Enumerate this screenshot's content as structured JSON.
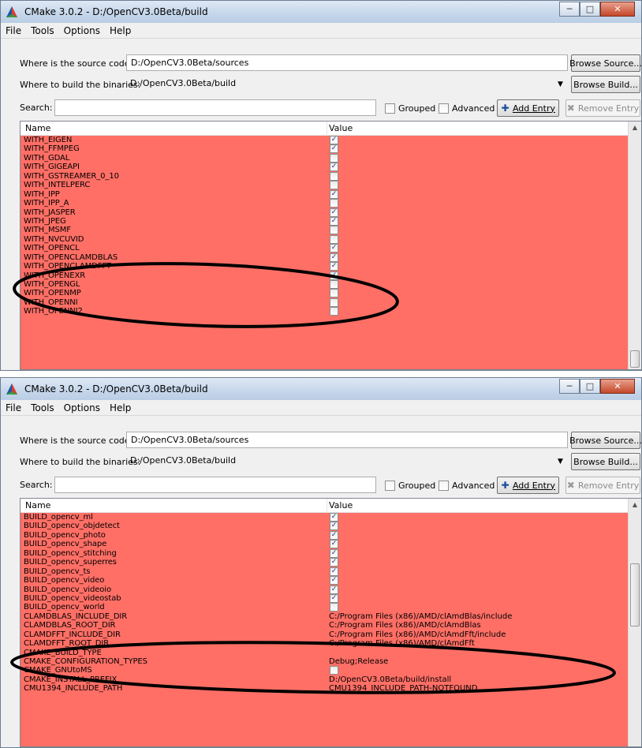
{
  "windows": [
    {
      "title": "CMake 3.0.2 - D:/OpenCV3.0Beta/build",
      "menu": [
        "File",
        "Tools",
        "Options",
        "Help"
      ],
      "source_label": "Where is the source code:",
      "source_value": "D:/OpenCV3.0Beta/sources",
      "browse_source": "Browse Source...",
      "build_label": "Where to build the binaries:",
      "build_value": "D:/OpenCV3.0Beta/build",
      "browse_build": "Browse Build...",
      "search_label": "Search:",
      "search_value": "",
      "grouped_label": "Grouped",
      "advanced_label": "Advanced",
      "add_entry": "Add Entry",
      "remove_entry": "Remove Entry",
      "col_name": "Name",
      "col_value": "Value",
      "rows": [
        {
          "name": "WITH_EIGEN",
          "checked": true
        },
        {
          "name": "WITH_FFMPEG",
          "checked": true
        },
        {
          "name": "WITH_GDAL",
          "checked": false
        },
        {
          "name": "WITH_GIGEAPI",
          "checked": true
        },
        {
          "name": "WITH_GSTREAMER_0_10",
          "checked": false
        },
        {
          "name": "WITH_INTELPERC",
          "checked": false
        },
        {
          "name": "WITH_IPP",
          "checked": true
        },
        {
          "name": "WITH_IPP_A",
          "checked": false
        },
        {
          "name": "WITH_JASPER",
          "checked": true
        },
        {
          "name": "WITH_JPEG",
          "checked": true
        },
        {
          "name": "WITH_MSMF",
          "checked": false
        },
        {
          "name": "WITH_NVCUVID",
          "checked": false
        },
        {
          "name": "WITH_OPENCL",
          "checked": true
        },
        {
          "name": "WITH_OPENCLAMDBLAS",
          "checked": true
        },
        {
          "name": "WITH_OPENCLAMDFFT",
          "checked": true
        },
        {
          "name": "WITH_OPENEXR",
          "checked": true
        },
        {
          "name": "WITH_OPENGL",
          "checked": false
        },
        {
          "name": "WITH_OPENMP",
          "checked": false
        },
        {
          "name": "WITH_OPENNI",
          "checked": false
        },
        {
          "name": "WITH_OPENNI2",
          "checked": false
        }
      ]
    },
    {
      "title": "CMake 3.0.2 - D:/OpenCV3.0Beta/build",
      "menu": [
        "File",
        "Tools",
        "Options",
        "Help"
      ],
      "source_label": "Where is the source code:",
      "source_value": "D:/OpenCV3.0Beta/sources",
      "browse_source": "Browse Source...",
      "build_label": "Where to build the binaries:",
      "build_value": "D:/OpenCV3.0Beta/build",
      "browse_build": "Browse Build...",
      "search_label": "Search:",
      "search_value": "",
      "grouped_label": "Grouped",
      "advanced_label": "Advanced",
      "add_entry": "Add Entry",
      "remove_entry": "Remove Entry",
      "col_name": "Name",
      "col_value": "Value",
      "rows": [
        {
          "name": "BUILD_opencv_ml",
          "checked": true
        },
        {
          "name": "BUILD_opencv_objdetect",
          "checked": true
        },
        {
          "name": "BUILD_opencv_photo",
          "checked": true
        },
        {
          "name": "BUILD_opencv_shape",
          "checked": true
        },
        {
          "name": "BUILD_opencv_stitching",
          "checked": true
        },
        {
          "name": "BUILD_opencv_superres",
          "checked": true
        },
        {
          "name": "BUILD_opencv_ts",
          "checked": true
        },
        {
          "name": "BUILD_opencv_video",
          "checked": true
        },
        {
          "name": "BUILD_opencv_videoio",
          "checked": true
        },
        {
          "name": "BUILD_opencv_videostab",
          "checked": true
        },
        {
          "name": "BUILD_opencv_world",
          "checked": false
        },
        {
          "name": "CLAMDBLAS_INCLUDE_DIR",
          "value": "C:/Program Files (x86)/AMD/clAmdBlas/include"
        },
        {
          "name": "CLAMDBLAS_ROOT_DIR",
          "value": "C:/Program Files (x86)/AMD/clAmdBlas"
        },
        {
          "name": "CLAMDFFT_INCLUDE_DIR",
          "value": "C:/Program Files (x86)/AMD/clAmdFft/include"
        },
        {
          "name": "CLAMDFFT_ROOT_DIR",
          "value": "C:/Program Files (x86)/AMD/clAmdFft"
        },
        {
          "name": "CMAKE_BUILD_TYPE",
          "value": ""
        },
        {
          "name": "CMAKE_CONFIGURATION_TYPES",
          "value": "Debug;Release"
        },
        {
          "name": "CMAKE_GNUtoMS",
          "checked": false
        },
        {
          "name": "CMAKE_INSTALL_PREFIX",
          "value": "D:/OpenCV3.0Beta/build/install"
        },
        {
          "name": "CMU1394_INCLUDE_PATH",
          "value": "CMU1394_INCLUDE_PATH-NOTFOUND"
        }
      ]
    }
  ],
  "colors": {
    "row_bg": "#ff6f66",
    "annotation": "#000000"
  },
  "icons": {
    "app": "cmake-triangle-icon",
    "add": "add-entry-icon",
    "remove": "remove-entry-icon"
  }
}
